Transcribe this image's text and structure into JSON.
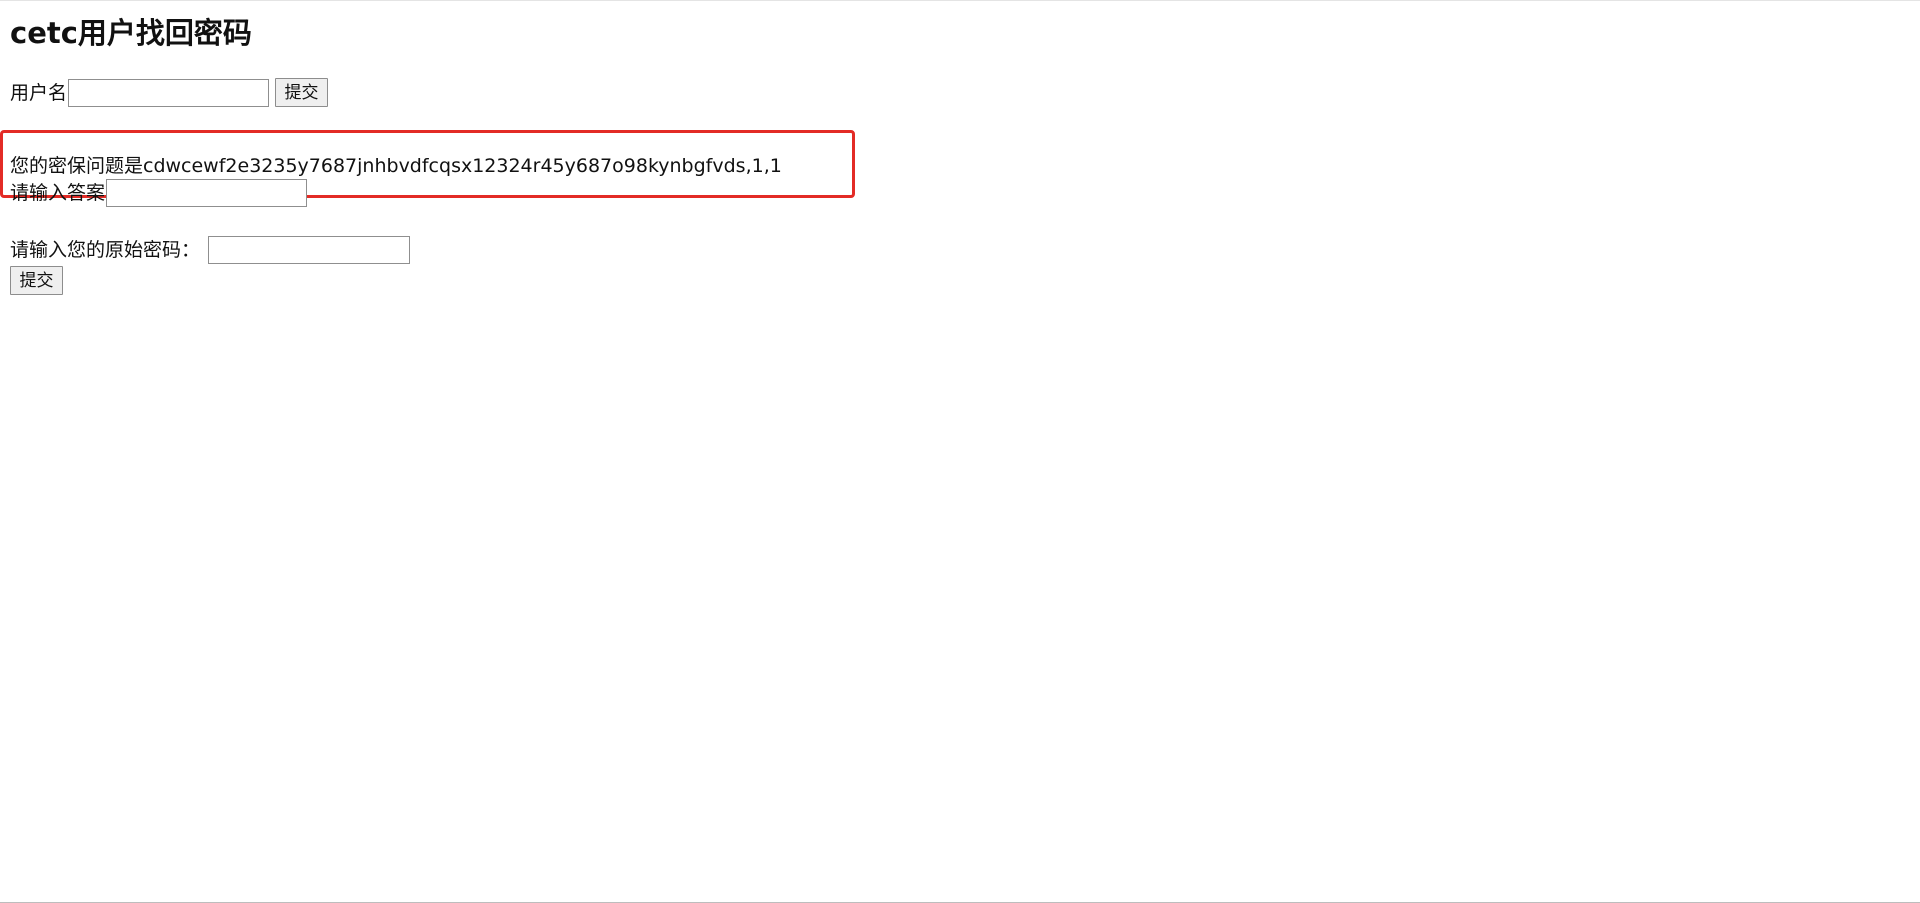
{
  "page": {
    "title": "cetc用户找回密码"
  },
  "username_form": {
    "label": "用户名",
    "value": "",
    "placeholder": "",
    "submit_label": "提交"
  },
  "security_question": {
    "text": "您的密保问题是cdwcewf2e3235y7687jnhbvdfcqsx12324r45y687o98kynbgfvds,1,1",
    "highlight_color": "#e32b26"
  },
  "answer_form": {
    "label": "请输入答案",
    "value": "",
    "placeholder": ""
  },
  "original_password_form": {
    "label": "请输入您的原始密码：",
    "value": "",
    "placeholder": "",
    "submit_label": "提交"
  }
}
